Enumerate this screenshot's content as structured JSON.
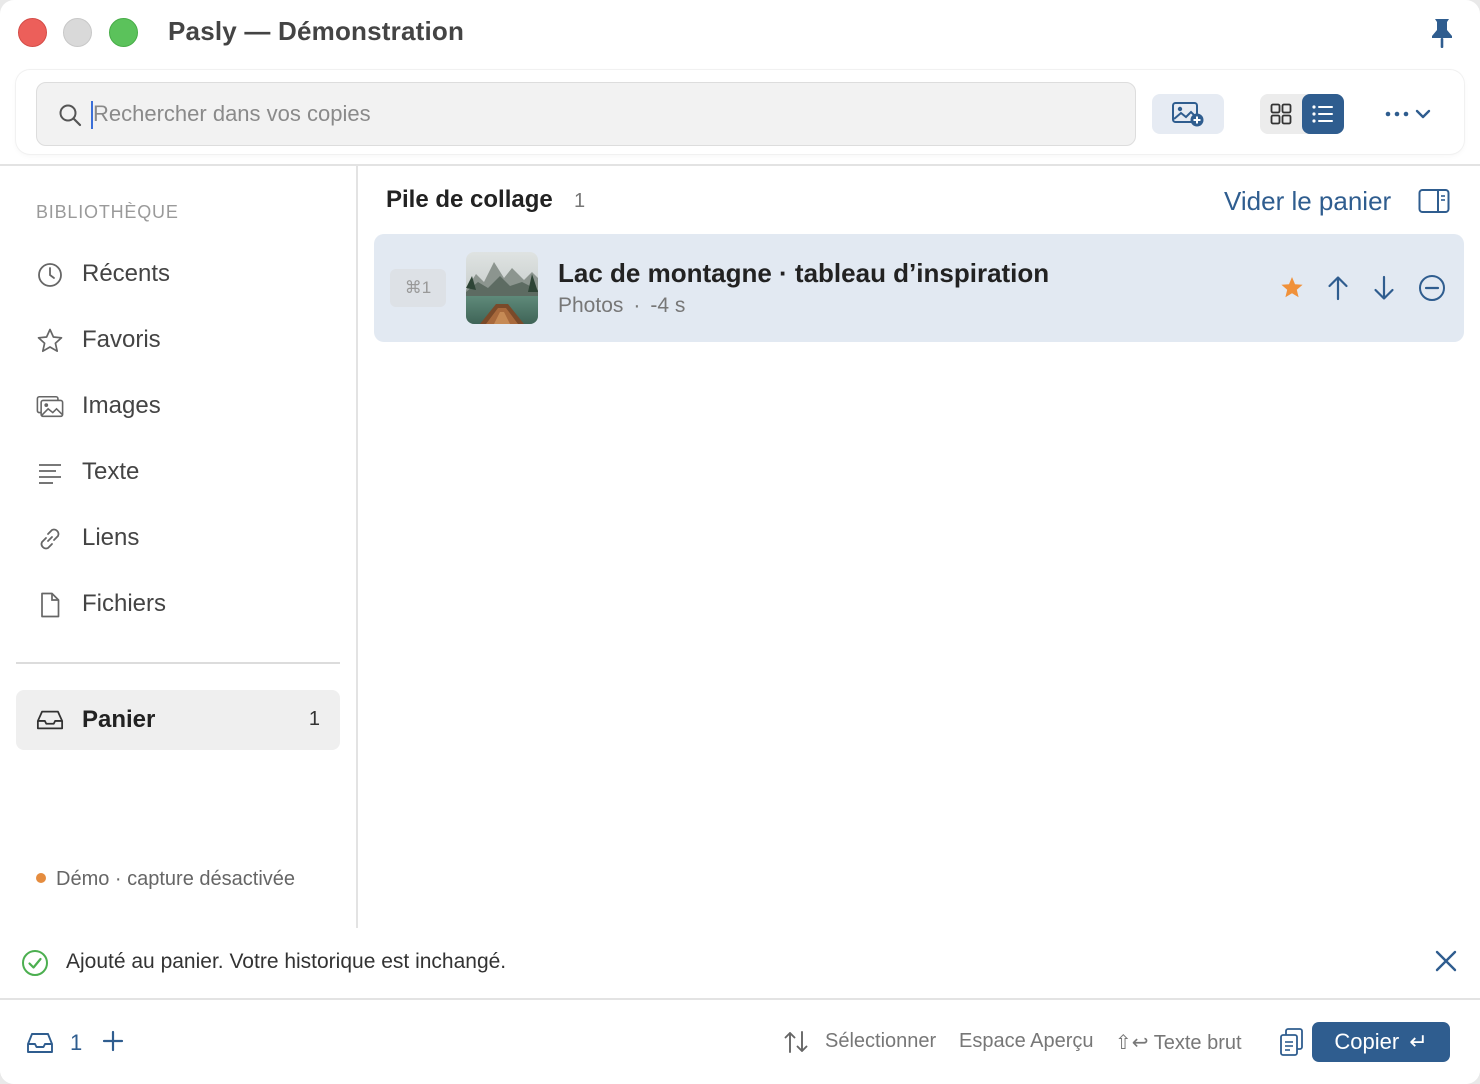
{
  "window": {
    "title": "Pasly — Démonstration"
  },
  "toolbar": {
    "search_placeholder": "Rechercher dans vos copies",
    "search_value": ""
  },
  "sidebar": {
    "section_title": "BIBLIOTHÈQUE",
    "items": [
      {
        "label": "Récents",
        "icon": "clock-icon"
      },
      {
        "label": "Favoris",
        "icon": "star-icon"
      },
      {
        "label": "Images",
        "icon": "images-icon"
      },
      {
        "label": "Texte",
        "icon": "text-lines-icon"
      },
      {
        "label": "Liens",
        "icon": "link-icon"
      },
      {
        "label": "Fichiers",
        "icon": "file-icon"
      }
    ],
    "basket": {
      "label": "Panier",
      "count": "1",
      "icon": "tray-icon"
    },
    "status": "Démo · capture désactivée",
    "status_color": "#e58c3e"
  },
  "main": {
    "title": "Pile de collage",
    "count": "1",
    "empty_label": "Vider le panier",
    "items": [
      {
        "shortcut": "⌘1",
        "title": "Lac de montagne · tableau d’inspiration",
        "source": "Photos",
        "meta_separator": "·",
        "age": "-4 s",
        "favorite": true
      }
    ]
  },
  "toast": {
    "message": "Ajouté au panier. Votre historique est inchangé."
  },
  "footer": {
    "basket_count": "1",
    "hints": {
      "select": "Sélectionner",
      "preview": "Espace Aperçu",
      "plain_prefix": "⇧↩",
      "plain": "Texte brut"
    },
    "copy_label": "Copier",
    "copy_key": "↵"
  },
  "colors": {
    "accent": "#2f5d8f",
    "selection": "#e2e9f2",
    "favorite": "#f0913a",
    "success": "#4caf50"
  }
}
